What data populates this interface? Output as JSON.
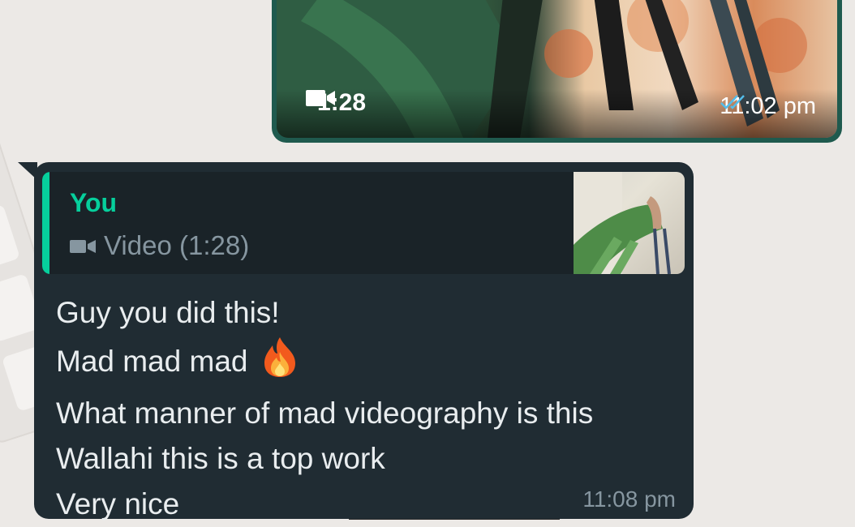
{
  "video_message": {
    "duration": "1:28",
    "timestamp": "11:02 pm",
    "status": "read"
  },
  "reply_message": {
    "quoted": {
      "sender": "You",
      "media_label": "Video (1:28)"
    },
    "lines": [
      "Guy you did this!",
      "Mad mad mad",
      "What manner of mad videography is this",
      "Wallahi this is a top work",
      "Very nice"
    ],
    "timestamp": "11:08 pm"
  },
  "colors": {
    "bubble_received": "#202c33",
    "bubble_sent_border": "#1f5a4e",
    "quote_accent": "#06cf9c",
    "read_ticks": "#53bdeb"
  },
  "icons": [
    "video-camera-icon",
    "double-check-icon",
    "fire-emoji-icon"
  ]
}
